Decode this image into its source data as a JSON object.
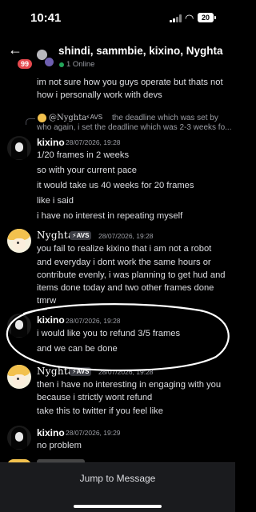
{
  "status_bar": {
    "time": "10:41",
    "battery": "20",
    "wifi_icon": "wifi-icon",
    "signal_icon": "cellular-signal-icon"
  },
  "header": {
    "back_icon": "arrow-left-icon",
    "unread_badge": "99",
    "channel_name": "shindi, sammbie, kixino, Nyghta",
    "online_status": "1 Online"
  },
  "messages": [
    {
      "lines": [
        "im not sure how you guys operate but thats not",
        "how i personally work with devs"
      ]
    },
    {
      "reply": {
        "author": "@Nyghta",
        "tag": "⚡AVS",
        "text_line1": "the deadline which was set by",
        "text_line2": "who again, i set the deadline which was 2-3 weeks fo..."
      },
      "author": "kixino",
      "timestamp": "28/07/2026, 19:28",
      "lines": [
        "1/20 frames in 2 weeks",
        "so with your current pace",
        "it would take us 40 weeks for 20 frames",
        "like i said",
        "i have no interest in repeating myself"
      ]
    },
    {
      "author": "Nyghta",
      "tag": "⚡AVS",
      "timestamp": "28/07/2026, 19:28",
      "lines": [
        "you fail to realize kixino that i am not a robot",
        "and everyday i dont work the same hours or",
        "contribute evenly, i was planning to get hud and",
        "items done today and two other frames done",
        "tmrw"
      ]
    },
    {
      "author": "kixino",
      "timestamp": "28/07/2026, 19:28",
      "lines": [
        "i would like you to refund 3/5 frames",
        "and we can be done"
      ]
    },
    {
      "author": "Nyghta",
      "tag": "⚡AVS",
      "timestamp": "28/07/2026, 19:28",
      "lines": [
        "then i have no interesting in engaging with you",
        "because i strictly wont refund",
        "take this to twitter if you feel like"
      ]
    },
    {
      "author": "kixino",
      "timestamp": "28/07/2026, 19:29",
      "lines": [
        "no problem"
      ]
    }
  ],
  "footer": {
    "jump_label": "Jump to Message"
  }
}
